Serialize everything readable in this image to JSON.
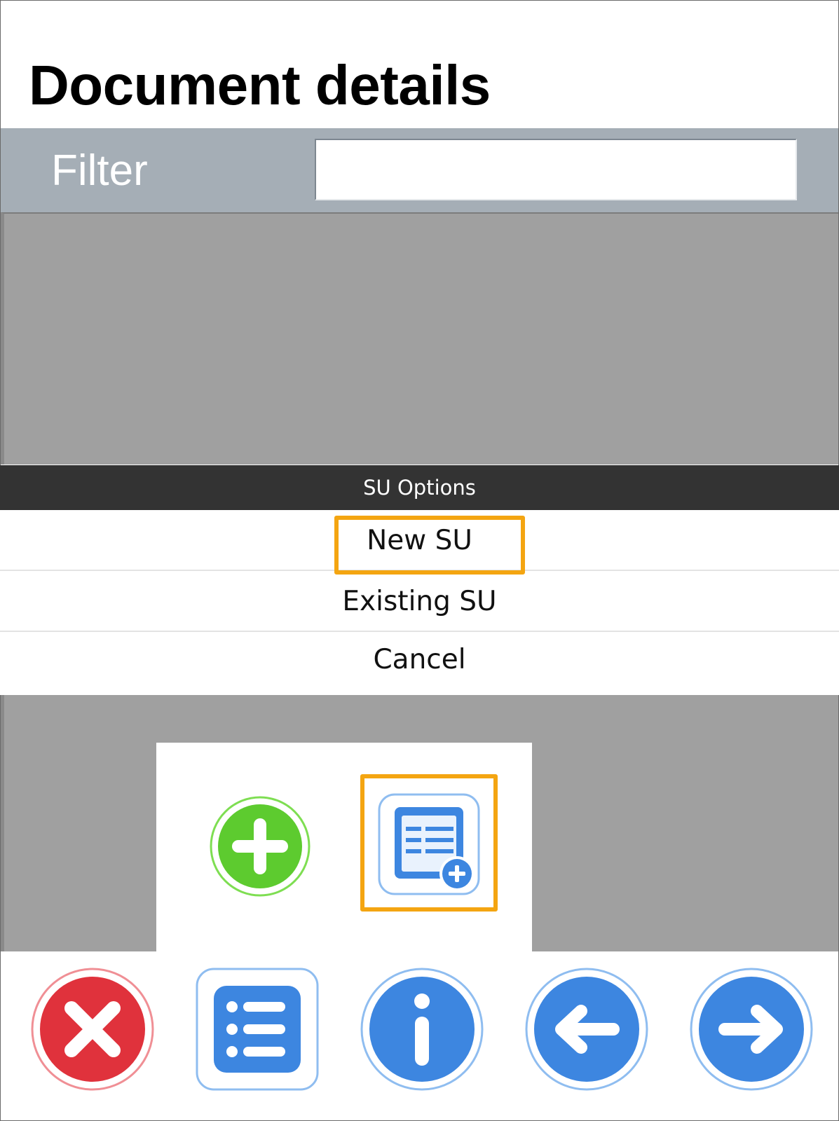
{
  "page": {
    "title": "Document details"
  },
  "filter": {
    "label": "Filter",
    "value": "",
    "placeholder": ""
  },
  "dialog": {
    "title": "SU Options",
    "options": [
      {
        "label": "New SU",
        "highlighted": true
      },
      {
        "label": "Existing SU",
        "highlighted": false
      },
      {
        "label": "Cancel",
        "highlighted": false
      }
    ]
  },
  "popup": {
    "icons": [
      {
        "icon": "plus-circle-icon",
        "color": "#5dcb2f",
        "highlighted": false
      },
      {
        "icon": "new-document-icon",
        "color": "#3d86e0",
        "highlighted": true
      }
    ]
  },
  "toolbar": {
    "icons": [
      {
        "icon": "close-icon",
        "color": "#e0323c"
      },
      {
        "icon": "list-icon",
        "color": "#3d86e0"
      },
      {
        "icon": "info-icon",
        "color": "#3d86e0"
      },
      {
        "icon": "arrow-left-icon",
        "color": "#3d86e0"
      },
      {
        "icon": "arrow-right-icon",
        "color": "#3d86e0"
      }
    ]
  },
  "colors": {
    "highlight": "#f4a511",
    "filter_bar": "#a5aeb6",
    "list_background": "#a0a0a0",
    "dialog_header": "#333333"
  }
}
